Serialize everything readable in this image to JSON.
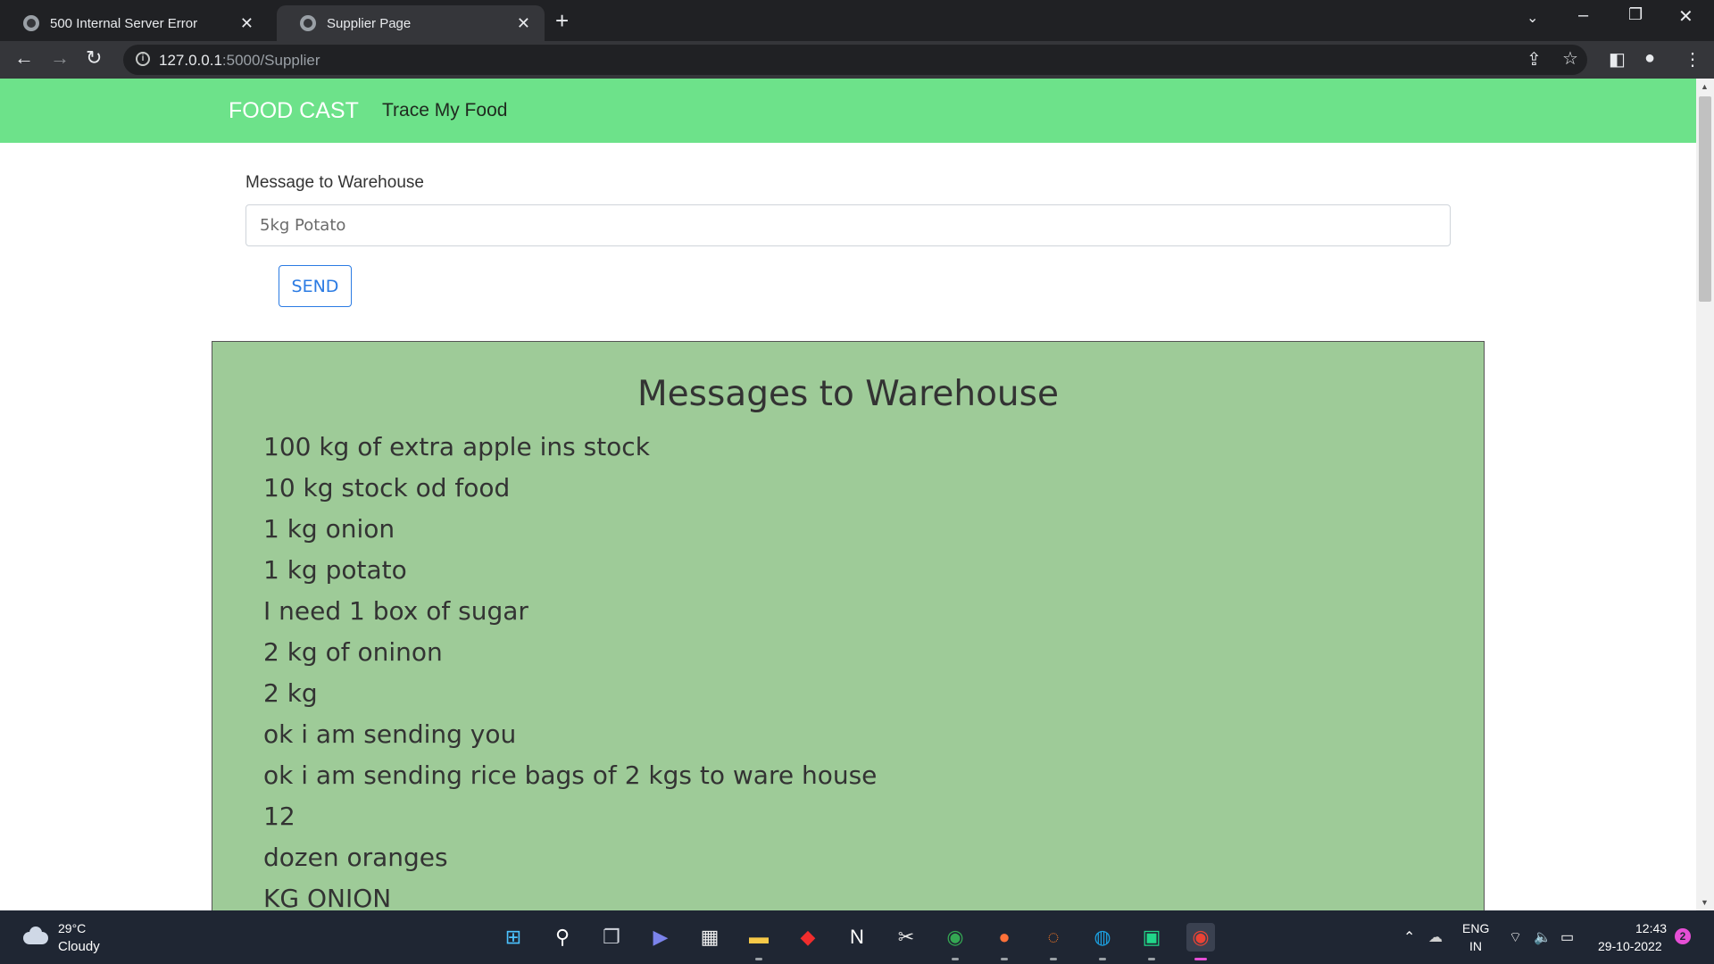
{
  "browser": {
    "tabs": [
      {
        "title": "500 Internal Server Error",
        "close": "✕"
      },
      {
        "title": "Supplier Page",
        "close": "✕"
      }
    ],
    "new_tab": "+",
    "url_host": "127.0.0.1",
    "url_path": ":5000/Supplier"
  },
  "navbar": {
    "brand": "FOOD CAST",
    "link": "Trace My Food"
  },
  "form": {
    "label": "Message to Warehouse",
    "placeholder": "5kg Potato",
    "send_label": "SEND"
  },
  "messages": {
    "title": "Messages to Warehouse",
    "items": [
      "100 kg of extra apple ins stock",
      "10 kg stock od food",
      "1 kg onion",
      "1 kg potato",
      "I need 1 box of sugar",
      "2 kg of oninon",
      "2 kg",
      "ok i am sending you",
      "ok i am sending rice bags of 2 kgs to ware house",
      "12",
      "dozen oranges",
      "KG ONION"
    ]
  },
  "taskbar": {
    "temperature": "29°C",
    "condition": "Cloudy",
    "lang_line1": "ENG",
    "lang_line2": "IN",
    "time": "12:43",
    "date": "29-10-2022",
    "notifications": "2"
  },
  "colors": {
    "navbar_bg": "#6de28a",
    "panel_bg": "#9ecb98",
    "send_accent": "#2b7be3"
  }
}
